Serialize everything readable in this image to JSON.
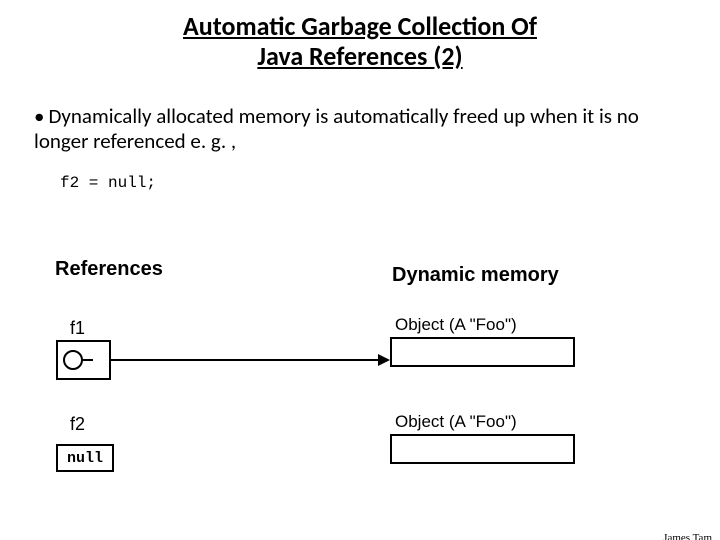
{
  "title_line1": "Automatic Garbage Collection Of",
  "title_line2": "Java References (2)",
  "bullet_text": "Dynamically allocated memory is automatically freed up when it is no longer referenced e. g. ,",
  "code": "f2 = null;",
  "headings": {
    "references": "References",
    "dynamic": "Dynamic memory"
  },
  "refs": {
    "f1": "f1",
    "f2": "f2"
  },
  "objects": {
    "obj1": "Object (A \"Foo\")",
    "obj2": "Object (A \"Foo\")"
  },
  "null_label": "null",
  "author": "James Tam"
}
